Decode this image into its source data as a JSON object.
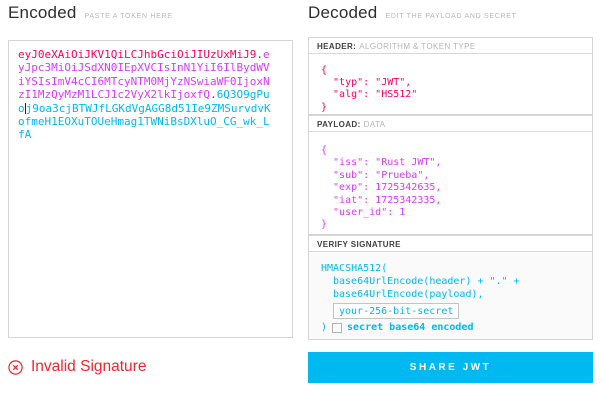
{
  "encoded": {
    "title": "Encoded",
    "subtitle": "PASTE A TOKEN HERE",
    "token": {
      "header_part": "eyJ0eXAiOiJKV1QiLCJhbGciOiJIUzUxMiJ9",
      "dot1": ".",
      "payload_part": "eyJpc3MiOiJSdXN0IEpXVCIsInN1YiI6IlBydWViYSIsImV4cCI6MTcyNTM0MjYzNSwiaWF0IjoxNzI1MzQyMzM1LCJ1c2VyX2lkIjoxfQ",
      "dot2": ".",
      "signature_before_caret": "6Q3O9gPuo",
      "signature_after_caret": "j9oa3cjBTWJfLGKdVgAGG8d51Ie9ZMSurvdvKofmeH1EOXuTOUeHmag1TWNiBsDXluO_CG_wk_LfA"
    }
  },
  "status": {
    "invalid_label": "Invalid Signature",
    "icon": "circle-x-icon"
  },
  "decoded": {
    "title": "Decoded",
    "subtitle": "EDIT THE PAYLOAD AND SECRET",
    "header_section": {
      "label_bold": "HEADER:",
      "label_light": "ALGORITHM & TOKEN TYPE",
      "json": "{\n  \"typ\": \"JWT\",\n  \"alg\": \"HS512\"\n}"
    },
    "payload_section": {
      "label_bold": "PAYLOAD:",
      "label_light": "DATA",
      "json": "{\n  \"iss\": \"Rust JWT\",\n  \"sub\": \"Prueba\",\n  \"exp\": 1725342635,\n  \"iat\": 1725342335,\n  \"user_id\": 1\n}"
    },
    "verify_section": {
      "label_bold": "VERIFY SIGNATURE",
      "line1": "HMACSHA512(",
      "line2": "base64UrlEncode(header) + \".\" +",
      "line3": "base64UrlEncode(payload),",
      "secret_value": "your-256-bit-secret",
      "close_paren": ")",
      "checkbox_checked": false,
      "checkbox_label": "secret base64 encoded"
    },
    "share_button_label": "SHARE JWT"
  },
  "colors": {
    "token_header": "#fb015b",
    "token_payload": "#d63aff",
    "token_signature": "#00b9f1",
    "invalid_red": "#f1262d",
    "accent_cyan": "#00b9f1"
  }
}
